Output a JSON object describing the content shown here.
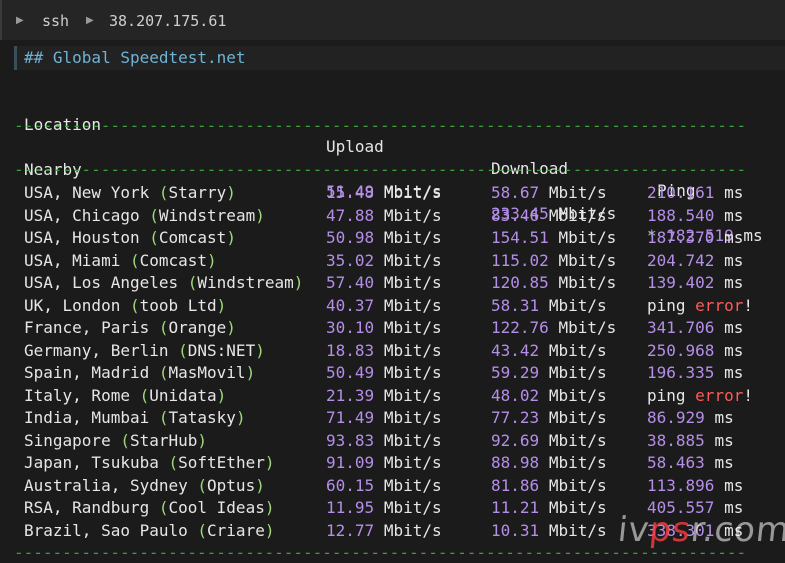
{
  "topbar": {
    "item1": "ssh",
    "item2": "38.207.175.61"
  },
  "section": {
    "heading": "## Global Speedtest.net"
  },
  "columns": {
    "location": "Location",
    "upload": "Upload",
    "download": "Download",
    "ping": "Ping"
  },
  "dashes": "-----------------------------------------------------------------------------",
  "units": {
    "speed": "Mbit/s",
    "ping": "ms"
  },
  "nearby": {
    "label": "Nearby",
    "upload": "51.49",
    "download": "233.45",
    "star": "*",
    "ping": "182.519"
  },
  "rows": [
    {
      "city": "USA, New York ",
      "open": "(",
      "provider": "Starry",
      "close": ")",
      "upload": "15.48",
      "download": "58.67",
      "ping": "210.161"
    },
    {
      "city": "USA, Chicago ",
      "open": "(",
      "provider": "Windstream",
      "close": ")",
      "upload": "47.88",
      "download": "83.46",
      "ping": "188.540"
    },
    {
      "city": "USA, Houston ",
      "open": "(",
      "provider": "Comcast",
      "close": ")",
      "upload": "50.98",
      "download": "154.51",
      "ping": "187.370"
    },
    {
      "city": "USA, Miami ",
      "open": "(",
      "provider": "Comcast",
      "close": ")",
      "upload": "35.02",
      "download": "115.02",
      "ping": "204.742"
    },
    {
      "city": "USA, Los Angeles ",
      "open": "(",
      "provider": "Windstream",
      "close": ")",
      "upload": "57.40",
      "download": "120.85",
      "ping": "139.402"
    },
    {
      "city": "UK, London ",
      "open": "(",
      "provider": "toob Ltd",
      "close": ")",
      "upload": "40.37",
      "download": "58.31",
      "ping_error": true,
      "ping_word": "ping ",
      "error_word": "error",
      "bang": "!"
    },
    {
      "city": "France, Paris ",
      "open": "(",
      "provider": "Orange",
      "close": ")",
      "upload": "30.10",
      "download": "122.76",
      "ping": "341.706"
    },
    {
      "city": "Germany, Berlin ",
      "open": "(",
      "provider": "DNS:NET",
      "close": ")",
      "upload": "18.83",
      "download": "43.42",
      "ping": "250.968"
    },
    {
      "city": "Spain, Madrid ",
      "open": "(",
      "provider": "MasMovil",
      "close": ")",
      "upload": "50.49",
      "download": "59.29",
      "ping": "196.335"
    },
    {
      "city": "Italy, Rome ",
      "open": "(",
      "provider": "Unidata",
      "close": ")",
      "upload": "21.39",
      "download": "48.02",
      "ping_error": true,
      "ping_word": "ping ",
      "error_word": "error",
      "bang": "!"
    },
    {
      "city": "India, Mumbai ",
      "open": "(",
      "provider": "Tatasky",
      "close": ")",
      "upload": "71.49",
      "download": "77.23",
      "ping": "86.929"
    },
    {
      "city": "Singapore ",
      "open": "(",
      "provider": "StarHub",
      "close": ")",
      "upload": "93.83",
      "download": "92.69",
      "ping": "38.885"
    },
    {
      "city": "Japan, Tsukuba ",
      "open": "(",
      "provider": "SoftEther",
      "close": ")",
      "upload": "91.09",
      "download": "88.98",
      "ping": "58.463"
    },
    {
      "city": "Australia, Sydney ",
      "open": "(",
      "provider": "Optus",
      "close": ")",
      "upload": "60.15",
      "download": "81.86",
      "ping": "113.896"
    },
    {
      "city": "RSA, Randburg ",
      "open": "(",
      "provider": "Cool Ideas",
      "close": ")",
      "upload": "11.95",
      "download": "11.21",
      "ping": "405.557"
    },
    {
      "city": "Brazil, Sao Paulo ",
      "open": "(",
      "provider": "Criare",
      "close": ")",
      "upload": "12.77",
      "download": "10.31",
      "ping": "338.301"
    }
  ],
  "watermark": {
    "left": "iv",
    "accent": "ps",
    "right": "r.com"
  },
  "colors": {
    "number": "#b58ee8",
    "paren": "#9fd97a",
    "error": "#ff5a5a",
    "dashes": "#3d9e3d",
    "heading": "#6fb3d6"
  }
}
